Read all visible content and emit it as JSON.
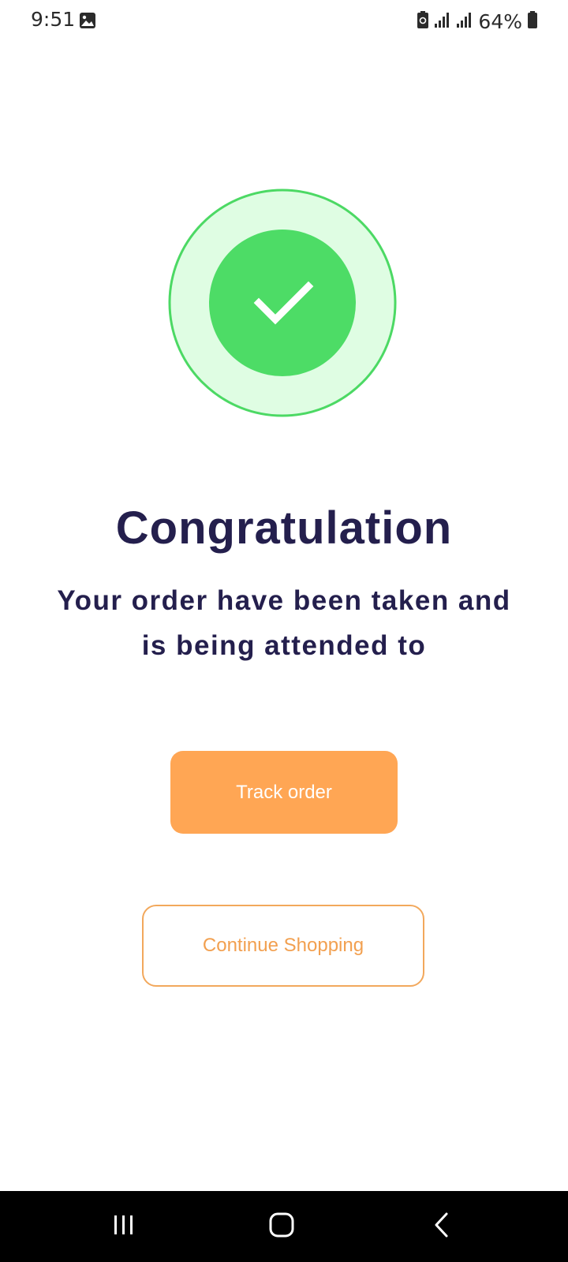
{
  "status_bar": {
    "time": "9:51",
    "battery_percent": "64%",
    "icons": [
      "gallery-icon",
      "battery-saver-icon",
      "signal-icon",
      "signal-icon",
      "battery-icon"
    ]
  },
  "success": {
    "icon": "checkmark-icon",
    "outer_ring_color": "#4cd964",
    "outer_fill_color": "#dffde3",
    "inner_fill_color": "#4ddc66"
  },
  "content": {
    "title": "Congratulation",
    "message_line1": "Your order have been taken and",
    "message_line2": "is being attended to"
  },
  "actions": {
    "track_order_label": "Track order",
    "continue_shopping_label": "Continue Shopping",
    "accent_color": "#ffa654"
  },
  "nav_bar": {
    "icons": [
      "recent-apps-icon",
      "home-icon",
      "back-icon"
    ]
  }
}
